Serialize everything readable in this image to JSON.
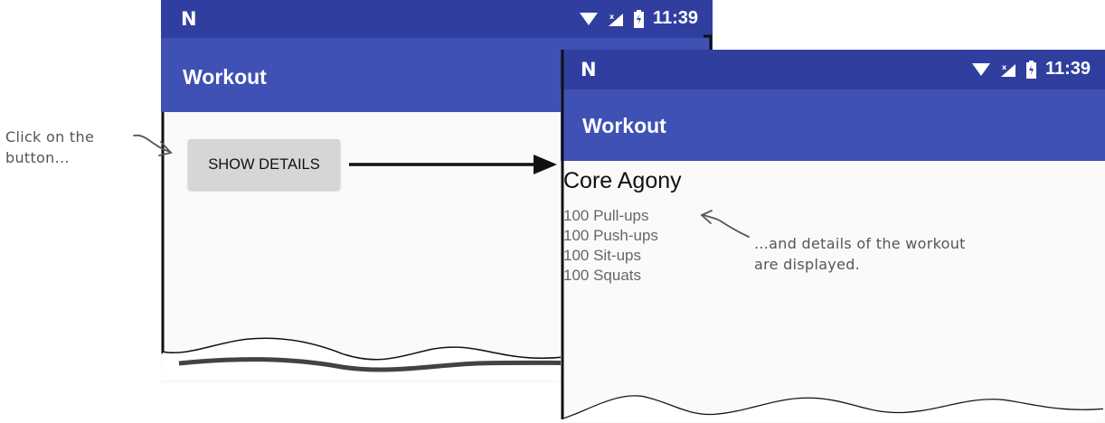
{
  "colors": {
    "status_bar": "#303f9f",
    "app_bar": "#3f51b5",
    "content_background": "#fafafa",
    "button_background": "#d6d6d6",
    "annotation_text": "#555555"
  },
  "screen_before": {
    "status_bar": {
      "notification_icon": "N",
      "icons": [
        "wifi-icon",
        "signal-icon",
        "battery-icon"
      ],
      "time": "11:39"
    },
    "app_bar": {
      "title": "Workout"
    },
    "button": {
      "label": "SHOW DETAILS"
    }
  },
  "screen_after": {
    "status_bar": {
      "notification_icon": "N",
      "icons": [
        "wifi-icon",
        "signal-icon",
        "battery-icon"
      ],
      "time": "11:39"
    },
    "app_bar": {
      "title": "Workout"
    },
    "workout": {
      "name": "Core Agony",
      "exercises": [
        "100 Pull-ups",
        "100 Push-ups",
        "100 Sit-ups",
        "100 Squats"
      ]
    }
  },
  "annotations": {
    "left": "Click on the button...",
    "right": "...and details of the workout are displayed."
  }
}
